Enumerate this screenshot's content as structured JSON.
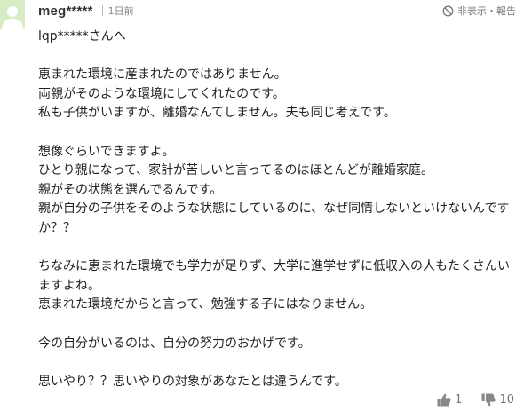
{
  "comment": {
    "avatar_icon": "user-avatar-icon",
    "username": "meg*****",
    "time": "1日前",
    "report_icon": "ban-icon",
    "report_label": "非表示・報告",
    "lines": [
      "lqp*****さんへ",
      "",
      "恵まれた環境に産まれたのではありません。",
      "両親がそのような環境にしてくれたのです。",
      "私も子供がいますが、離婚なんてしません。夫も同じ考えです。",
      "",
      "想像ぐらいできますよ。",
      "ひとり親になって、家計が苦しいと言ってるのはほとんどが離婚家庭。",
      "親がその状態を選んでるんです。",
      "親が自分の子供をそのような状態にしているのに、なぜ同情しないといけないんですか？？",
      "",
      "ちなみに恵まれた環境でも学力が足りず、大学に進学せずに低収入の人もたくさんいますよね。",
      "恵まれた環境だからと言って、勉強する子にはなりません。",
      "",
      "今の自分がいるのは、自分の努力のおかげです。",
      "",
      "思いやり？？思いやりの対象があなたとは違うんです。"
    ],
    "votes": {
      "up_icon": "thumbs-up-icon",
      "up_count": "1",
      "down_icon": "thumbs-down-icon",
      "down_count": "10"
    },
    "colors": {
      "avatar_bg": "#d6ecc4",
      "avatar_fg": "#ffffff",
      "text": "#222222",
      "muted": "#777777"
    }
  }
}
